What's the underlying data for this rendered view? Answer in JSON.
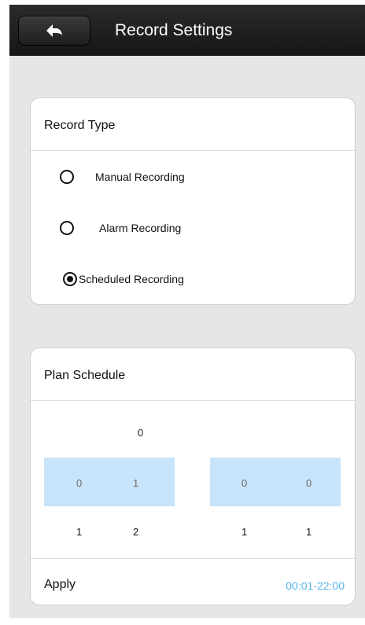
{
  "header": {
    "title": "Record Settings",
    "back_icon": "arrow-left-icon"
  },
  "record_type": {
    "title": "Record Type",
    "options": [
      {
        "label": "Manual Recording",
        "selected": false
      },
      {
        "label": "Alarm Recording",
        "selected": false
      },
      {
        "label": "Scheduled Recording",
        "selected": true
      }
    ]
  },
  "plan_schedule": {
    "title": "Plan Schedule",
    "top_digit": "0",
    "band_digits": [
      "0",
      "1",
      "0",
      "0"
    ],
    "bottom_digits": [
      "1",
      "2",
      "1",
      "1"
    ],
    "apply_label": "Apply",
    "time_range": "00:01-22:00"
  },
  "colors": {
    "header_bg": "#1a1a1a",
    "screen_bg": "#e6e6e6",
    "band_bg": "#c7e4fa",
    "accent": "#56b4ea"
  }
}
